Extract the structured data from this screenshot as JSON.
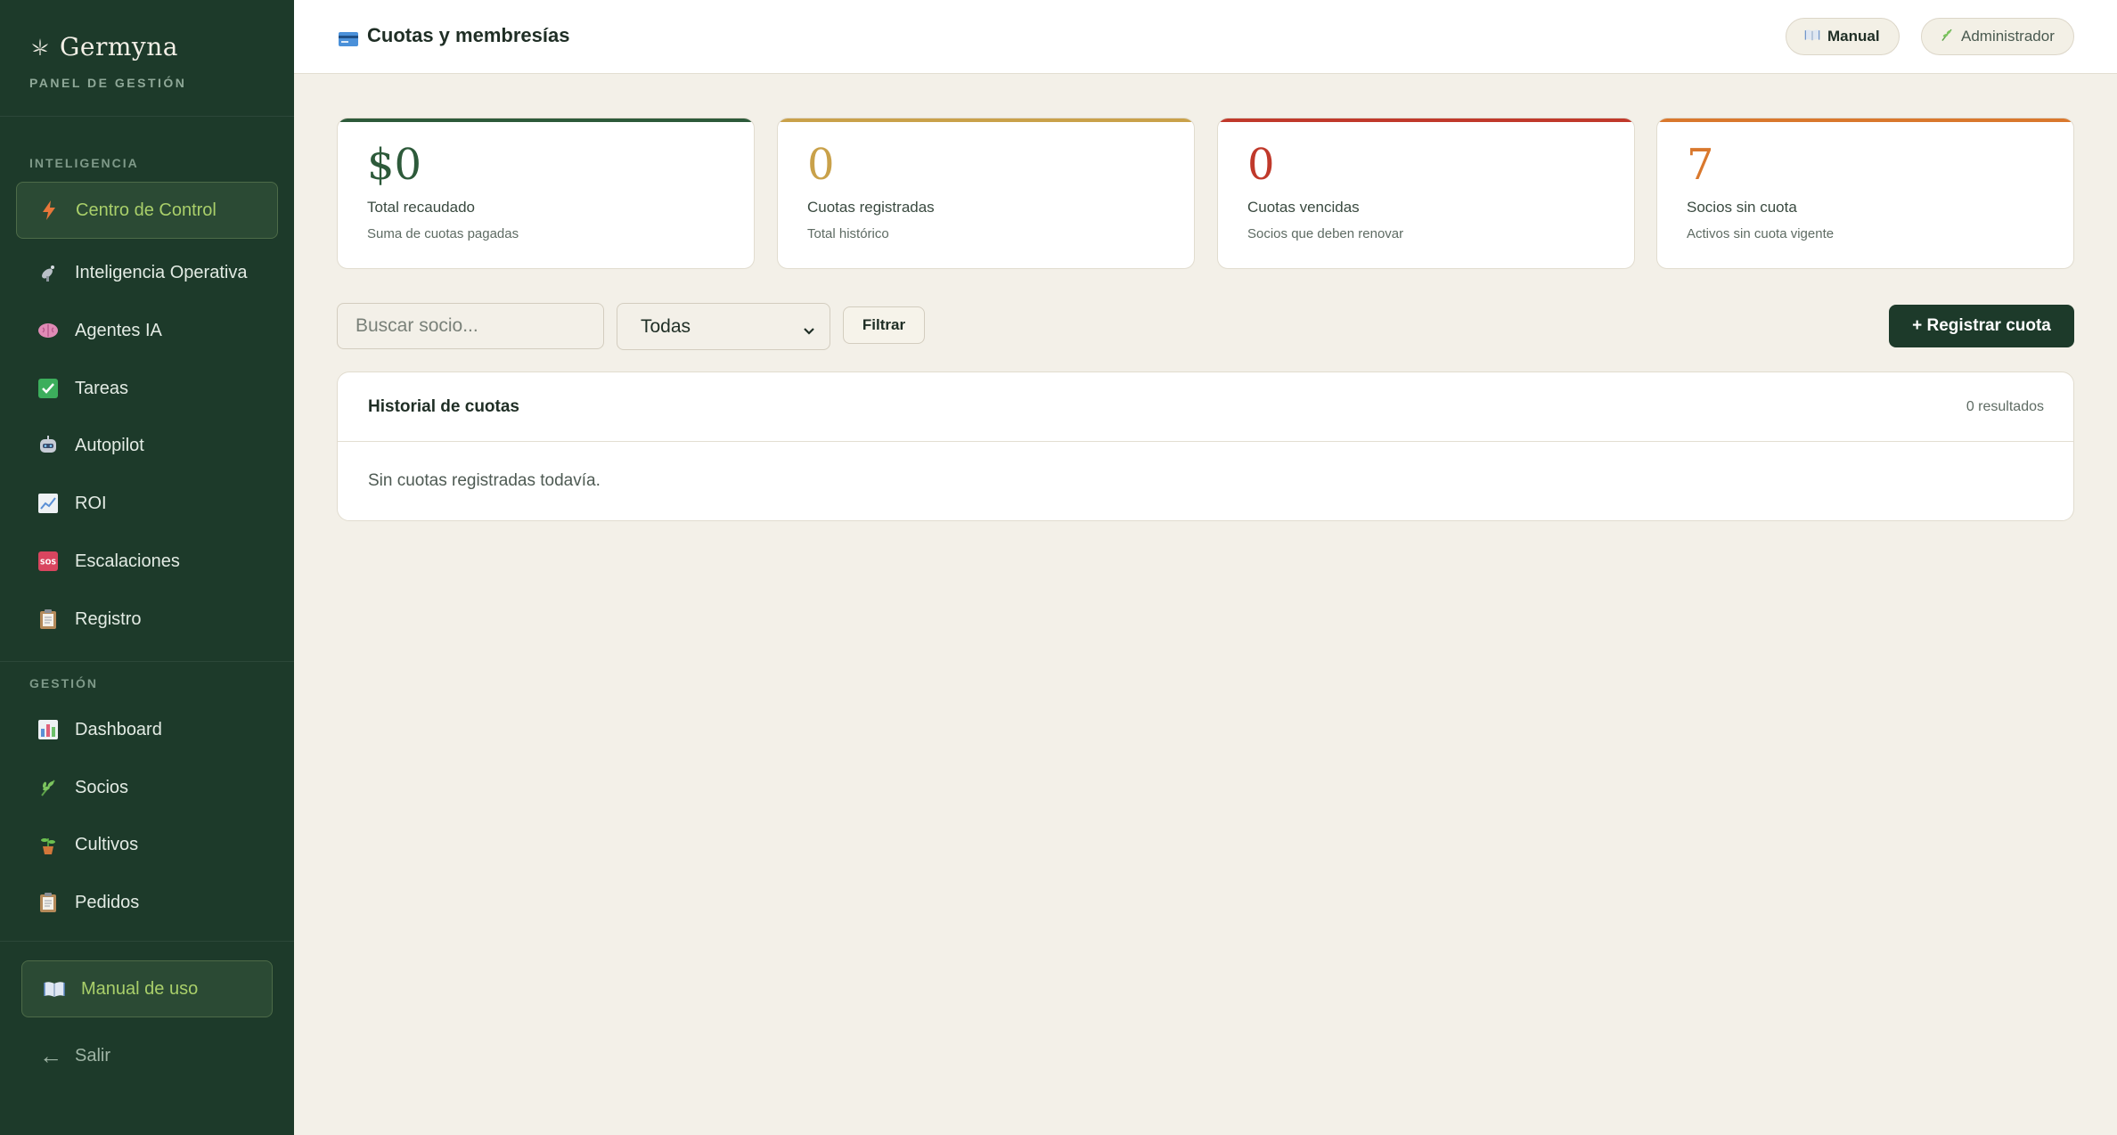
{
  "brand": {
    "name": "Germyna",
    "subtitle": "PANEL DE GESTIÓN"
  },
  "sidebar": {
    "sections": [
      {
        "label": "INTELIGENCIA",
        "items": [
          {
            "label": "Centro de Control",
            "icon": "lightning-icon",
            "active": true
          },
          {
            "label": "Inteligencia Operativa",
            "icon": "satellite-dish-icon"
          },
          {
            "label": "Agentes IA",
            "icon": "brain-icon"
          },
          {
            "label": "Tareas",
            "icon": "check-box-icon"
          },
          {
            "label": "Autopilot",
            "icon": "robot-icon"
          },
          {
            "label": "ROI",
            "icon": "chart-increasing-icon"
          },
          {
            "label": "Escalaciones",
            "icon": "sos-icon"
          },
          {
            "label": "Registro",
            "icon": "clipboard-icon"
          }
        ]
      },
      {
        "label": "GESTIÓN",
        "items": [
          {
            "label": "Dashboard",
            "icon": "bar-chart-icon"
          },
          {
            "label": "Socios",
            "icon": "herb-icon"
          },
          {
            "label": "Cultivos",
            "icon": "potted-plant-icon"
          },
          {
            "label": "Pedidos",
            "icon": "clipboard-icon"
          }
        ]
      }
    ],
    "manual_label": "Manual de uso",
    "logout_label": "Salir"
  },
  "header": {
    "title": "Cuotas y membresías",
    "title_icon": "credit-card-icon",
    "manual_label": "Manual",
    "user_label": "Administrador"
  },
  "stats": [
    {
      "value": "$0",
      "label": "Total recaudado",
      "sub": "Suma de cuotas pagadas",
      "color": "#2d5a3a"
    },
    {
      "value": "0",
      "label": "Cuotas registradas",
      "sub": "Total histórico",
      "color": "#c9a14a"
    },
    {
      "value": "0",
      "label": "Cuotas vencidas",
      "sub": "Socios que deben renovar",
      "color": "#c0392b"
    },
    {
      "value": "7",
      "label": "Socios sin cuota",
      "sub": "Activos sin cuota vigente",
      "color": "#d9782d"
    }
  ],
  "filters": {
    "search_placeholder": "Buscar socio...",
    "status_selected": "Todas",
    "filter_label": "Filtrar",
    "register_label": "+ Registrar cuota"
  },
  "history": {
    "title": "Historial de cuotas",
    "count": "0 resultados",
    "empty": "Sin cuotas registradas todavía."
  },
  "colors": {
    "sidebar_bg": "#1d3a2a",
    "page_bg": "#f3f0e8",
    "accent_green": "#a9cf6a",
    "primary_button": "#1d3a2a"
  }
}
